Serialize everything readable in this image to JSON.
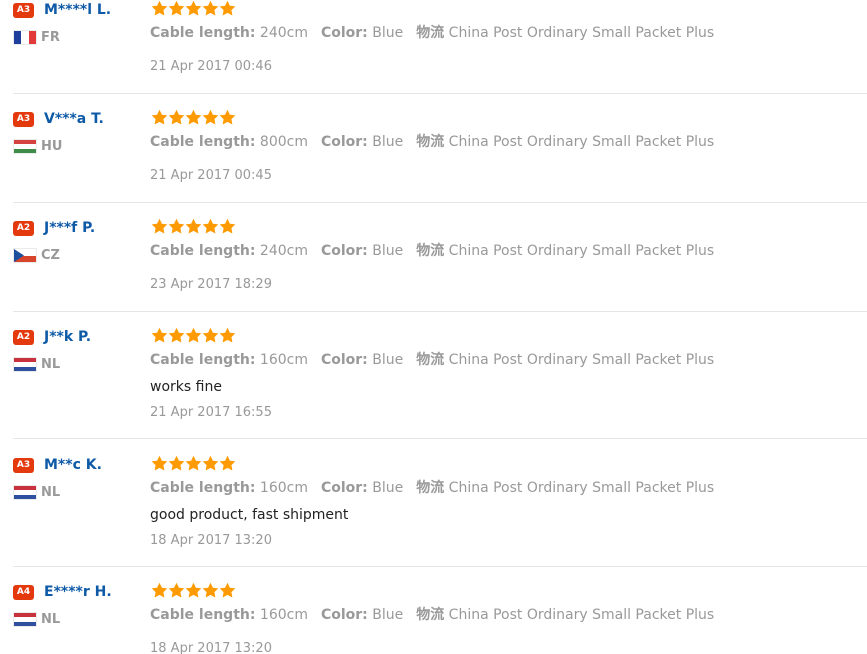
{
  "colors": {
    "user_name": "#0e5aa7",
    "meta_text": "#999999",
    "feedback_text": "#222222",
    "star": "#ff9a00",
    "badge": "#e4380d",
    "separator": "#e6e6e6"
  },
  "reviews": [
    {
      "badge": "A3",
      "name": "M****l L.",
      "country": "FR",
      "stars": 5,
      "props": [
        {
          "key": "Cable length:",
          "value": "240cm"
        },
        {
          "key": "Color:",
          "value": "Blue"
        },
        {
          "key": "物流",
          "value": "China Post Ordinary Small Packet Plus"
        }
      ],
      "feedback": "",
      "date": "21 Apr 2017 00:46"
    },
    {
      "badge": "A3",
      "name": "V***a T.",
      "country": "HU",
      "stars": 5,
      "props": [
        {
          "key": "Cable length:",
          "value": "800cm"
        },
        {
          "key": "Color:",
          "value": "Blue"
        },
        {
          "key": "物流",
          "value": "China Post Ordinary Small Packet Plus"
        }
      ],
      "feedback": "",
      "date": "21 Apr 2017 00:45"
    },
    {
      "badge": "A2",
      "name": "J***f P.",
      "country": "CZ",
      "stars": 5,
      "props": [
        {
          "key": "Cable length:",
          "value": "240cm"
        },
        {
          "key": "Color:",
          "value": "Blue"
        },
        {
          "key": "物流",
          "value": "China Post Ordinary Small Packet Plus"
        }
      ],
      "feedback": "",
      "date": "23 Apr 2017 18:29"
    },
    {
      "badge": "A2",
      "name": "J**k P.",
      "country": "NL",
      "stars": 5,
      "props": [
        {
          "key": "Cable length:",
          "value": "160cm"
        },
        {
          "key": "Color:",
          "value": "Blue"
        },
        {
          "key": "物流",
          "value": "China Post Ordinary Small Packet Plus"
        }
      ],
      "feedback": "works fine",
      "date": "21 Apr 2017 16:55"
    },
    {
      "badge": "A3",
      "name": "M**c K.",
      "country": "NL",
      "stars": 5,
      "props": [
        {
          "key": "Cable length:",
          "value": "160cm"
        },
        {
          "key": "Color:",
          "value": "Blue"
        },
        {
          "key": "物流",
          "value": "China Post Ordinary Small Packet Plus"
        }
      ],
      "feedback": "good product, fast shipment",
      "date": "18 Apr 2017 13:20"
    },
    {
      "badge": "A4",
      "name": "E****r H.",
      "country": "NL",
      "stars": 5,
      "props": [
        {
          "key": "Cable length:",
          "value": "160cm"
        },
        {
          "key": "Color:",
          "value": "Blue"
        },
        {
          "key": "物流",
          "value": "China Post Ordinary Small Packet Plus"
        }
      ],
      "feedback": "",
      "date": "18 Apr 2017 13:20"
    }
  ]
}
